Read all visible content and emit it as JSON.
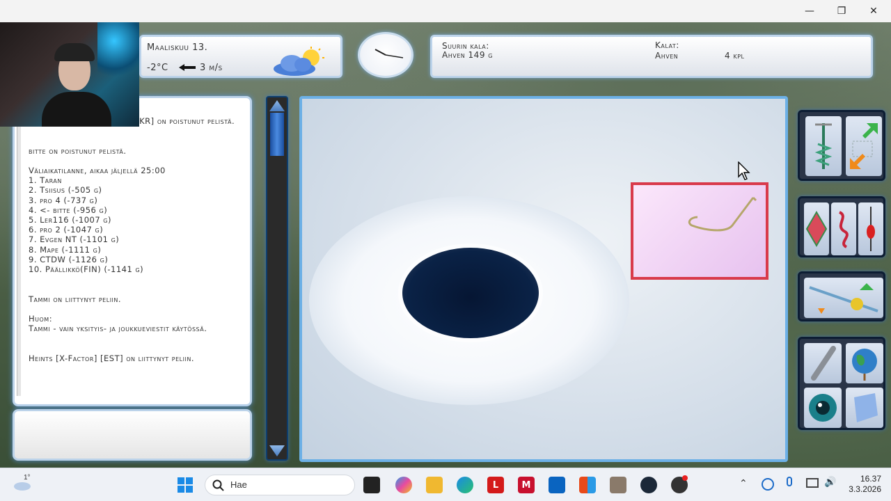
{
  "window": {
    "minimize_glyph": "—",
    "restore_glyph": "❐",
    "close_glyph": "✕"
  },
  "hud": {
    "date": "Maaliskuu 13.",
    "temperature": "-2°C",
    "wind_speed": "3 m/s",
    "biggest_label": "Suurin kala:",
    "biggest_value": "Ahven 149 g",
    "catch_label": "Kalat:",
    "catch_species": "Ahven",
    "catch_count": "4 kpl"
  },
  "chat": {
    "lines": [
      "AlexSharpHook [Riggers] [UKR] on poistunut pelistä.",
      "",
      "",
      "bitte on poistunut pelistä.",
      "",
      "Väliaikatilanne, aikaa jäljellä 25:00",
      "1. Taran",
      "2. Tsiisus (-505 g)",
      "3. pro 4 (-737 g)",
      "4. <- bitte (-956 g)",
      "5. Ler116 (-1007 g)",
      "6. pro 2 (-1047 g)",
      "7. Evgen NT (-1101 g)",
      "8. Mape (-1111 g)",
      "9. CTDW (-1126 g)",
      "10. Päällikkö(FIN) (-1141 g)",
      "",
      "",
      "Tammi on liittynyt peliin.",
      "",
      "Huom:",
      "Tammi - vain yksityis- ja joukkueviestit käytössä.",
      "",
      "",
      "Heints [X-Factor] [EST] on liittynyt peliin."
    ]
  },
  "taskbar": {
    "weather_temp": "1°",
    "search_placeholder": "Hae",
    "time": "16.37",
    "date": "3.3.2026"
  },
  "colors": {
    "hook_box_border": "#d93a4b",
    "panel_glow": "#bcd3ea",
    "hole": "#0a2246"
  }
}
